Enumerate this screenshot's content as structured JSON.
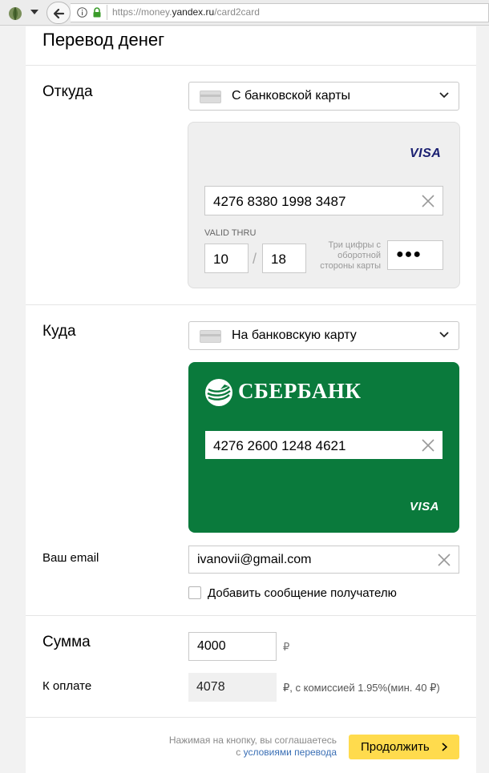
{
  "browser": {
    "url_prefix": "https://money.",
    "url_domain": "yandex.ru",
    "url_path": "/card2card"
  },
  "page": {
    "title": "Перевод денег"
  },
  "from": {
    "label": "Откуда",
    "source_option": "С банковской карты",
    "card": {
      "network": "VISA",
      "number": "4276 8380 1998 3487",
      "valid_thru_label": "VALID THRU",
      "month": "10",
      "year": "18",
      "separator": "/",
      "cvv_hint": "Три цифры с оборотной стороны карты",
      "cvv_masked": "●●●"
    }
  },
  "to": {
    "label": "Куда",
    "destination_option": "На банковскую карту",
    "card": {
      "bank_name": "СБЕРБАНК",
      "number": "4276 2600 1248 4621",
      "network": "VISA",
      "bg_color": "#0a7a3c"
    }
  },
  "email": {
    "label": "Ваш email",
    "value": "ivanovii@gmail.com",
    "message_checkbox_label": "Добавить сообщение получателю",
    "message_checked": false
  },
  "amount": {
    "label": "Сумма",
    "value": "4000",
    "currency": "₽",
    "to_pay_label": "К оплате",
    "to_pay_value": "4078",
    "commission_text": "₽, с комиссией 1.95%(мин. 40 ₽)"
  },
  "footer": {
    "agree_prefix": "Нажимая на кнопку, вы соглашаетесь",
    "agree_with": "с ",
    "agree_link": "условиями перевода",
    "continue_label": "Продолжить",
    "accent_color": "#ffdb4d"
  }
}
